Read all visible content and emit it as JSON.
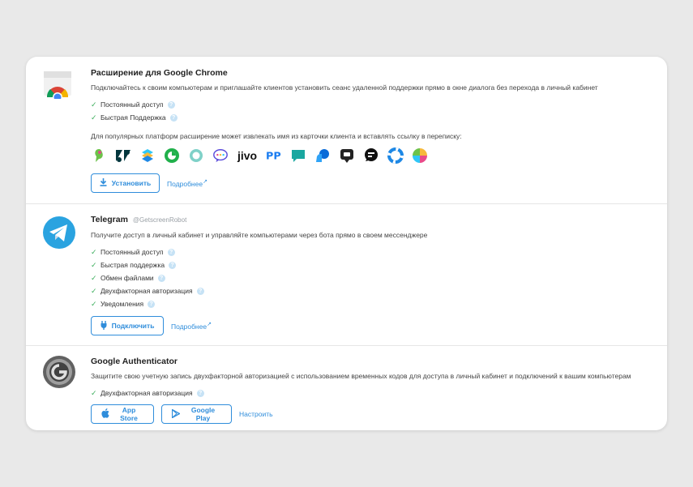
{
  "chrome": {
    "title": "Расширение для Google Chrome",
    "description": "Подключайтесь к своим компьютерам и приглашайте клиентов установить сеанс удаленной поддержки прямо в окне диалога без перехода в личный кабинет",
    "features": [
      "Постоянный доступ",
      "Быстрая Поддержка"
    ],
    "platforms_text": "Для популярных платформ расширение может извлекать имя из карточки клиента и вставлять ссылку в переписку:",
    "platforms_jivo_label": "jivo",
    "install_label": "Установить",
    "more_label": "Подробнее"
  },
  "telegram": {
    "title": "Telegram",
    "handle": "@GetscreenRobot",
    "description": "Получите доступ в личный кабинет и управляйте компьютерами через бота прямо в своем мессенджере",
    "features": [
      "Постоянный доступ",
      "Быстрая поддержка",
      "Обмен файлами",
      "Двухфакторная авторизация",
      "Уведомления"
    ],
    "connect_label": "Подключить",
    "more_label": "Подробнее"
  },
  "authenticator": {
    "title": "Google Authenticator",
    "description": "Защитите свою учетную запись двухфакторной авторизацией с использованием временных кодов для доступа в личный кабинет и подключений к вашим компьютерам",
    "features": [
      "Двухфакторная авторизация"
    ],
    "appstore_label": "App Store",
    "googleplay_label": "Google Play",
    "setup_label": "Настроить"
  },
  "colors": {
    "accent": "#2f8ddb",
    "check": "#3cae5c",
    "help": "#c6e2f5"
  }
}
